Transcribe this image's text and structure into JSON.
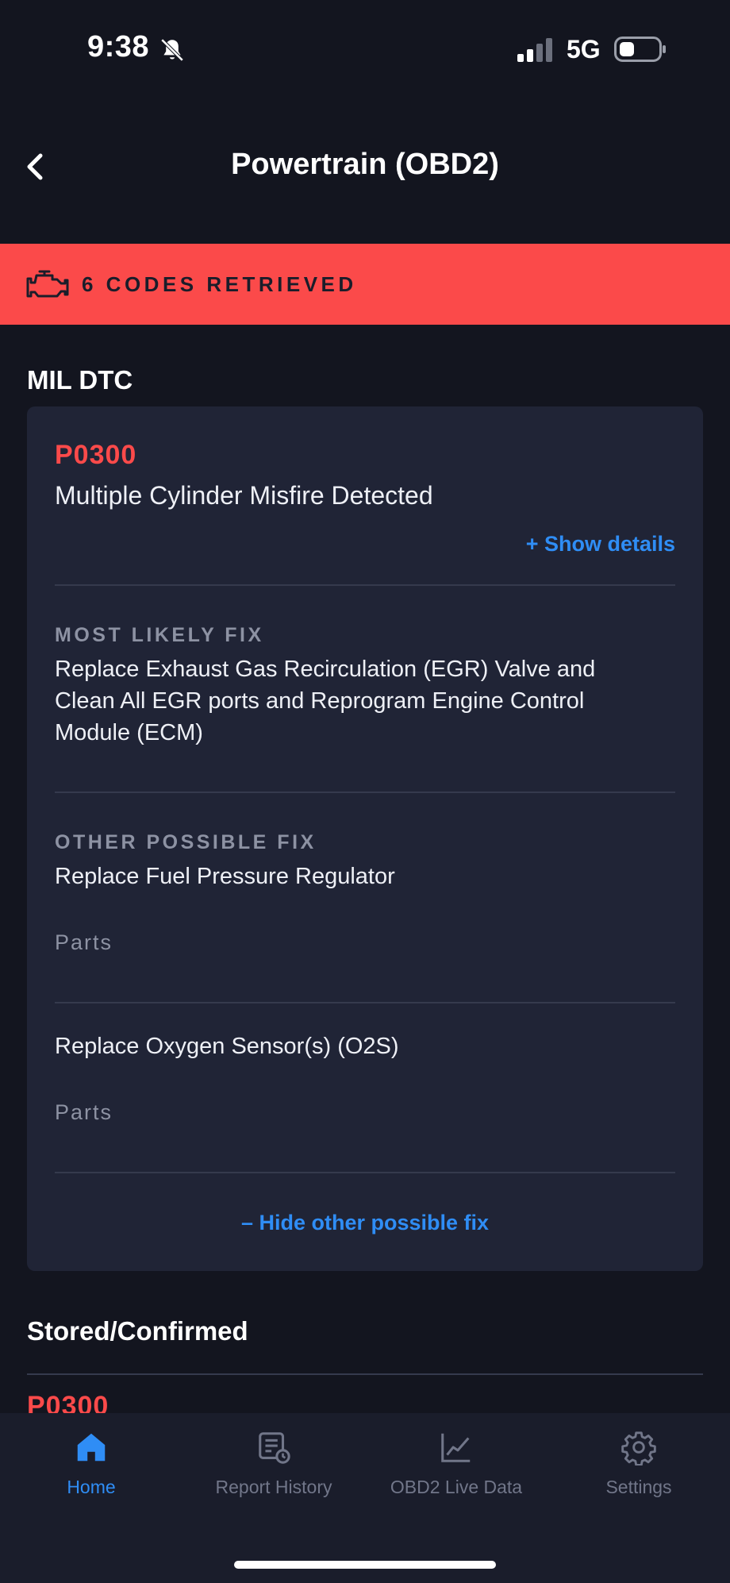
{
  "status_bar": {
    "time": "9:38",
    "network": "5G"
  },
  "header": {
    "title": "Powertrain (OBD2)"
  },
  "banner": {
    "text": "6 CODES RETRIEVED",
    "color": "#fb4a4a"
  },
  "sections": {
    "mil_title": "MIL DTC",
    "stored_title": "Stored/Confirmed"
  },
  "dtc": {
    "code": "P0300",
    "description": "Multiple Cylinder Misfire Detected",
    "show_details": "+ Show details",
    "most_likely_label": "MOST LIKELY FIX",
    "most_likely_fix": "Replace Exhaust Gas Recirculation (EGR) Valve and Clean All EGR ports and Reprogram Engine Control Module (ECM)",
    "other_label": "OTHER POSSIBLE FIX",
    "other_fixes": [
      {
        "text": "Replace Fuel Pressure Regulator",
        "parts": "Parts"
      },
      {
        "text": "Replace Oxygen Sensor(s) (O2S)",
        "parts": "Parts"
      }
    ],
    "hide_other": "– Hide other possible fix"
  },
  "stored_preview_code": "P0300",
  "tabs": [
    {
      "label": "Home",
      "icon": "home-icon",
      "active": true
    },
    {
      "label": "Report History",
      "icon": "report-icon",
      "active": false
    },
    {
      "label": "OBD2 Live Data",
      "icon": "chart-icon",
      "active": false
    },
    {
      "label": "Settings",
      "icon": "gear-icon",
      "active": false
    }
  ],
  "colors": {
    "background": "#13151f",
    "card": "#202436",
    "accent_red": "#fb4a4a",
    "accent_blue": "#2f8df5"
  }
}
